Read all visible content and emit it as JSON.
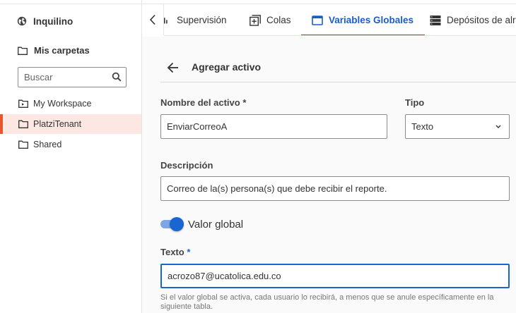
{
  "sidebar": {
    "tenant_label": "Inquilino",
    "folders_header": "Mis carpetas",
    "search_placeholder": "Buscar",
    "items": [
      {
        "label": "My Workspace",
        "icon": "workspace-folder-icon",
        "active": false
      },
      {
        "label": "PlatziTenant",
        "icon": "folder-icon",
        "active": true
      },
      {
        "label": "Shared",
        "icon": "folder-icon",
        "active": false
      }
    ]
  },
  "tabs": [
    {
      "label": "Supervisión",
      "icon": "bar-chart-icon",
      "active": false
    },
    {
      "label": "Colas",
      "icon": "queues-icon",
      "active": false
    },
    {
      "label": "Variables Globales",
      "icon": "window-icon",
      "active": true
    },
    {
      "label": "Depósitos de alr",
      "icon": "storage-icon",
      "active": false
    }
  ],
  "page": {
    "title": "Agregar activo"
  },
  "form": {
    "name_label": "Nombre del activo",
    "name_required": "*",
    "name_value": "EnviarCorreoA",
    "type_label": "Tipo",
    "type_value": "Texto",
    "description_label": "Descripción",
    "description_value": "Correo de la(s) persona(s) que debe recibir el reporte.",
    "global_toggle_label": "Valor global",
    "global_toggle_on": true,
    "text_label": "Texto",
    "text_required": "*",
    "text_value": "acrozo87@ucatolica.edu.co",
    "help_text": "Si el valor global se activa, cada usuario lo recibirá, a menos que se anule específicamente en la siguiente tabla."
  },
  "colors": {
    "accent": "#1a66d1",
    "active_item_bg": "#fde7e3",
    "active_item_border": "#e8562f"
  }
}
